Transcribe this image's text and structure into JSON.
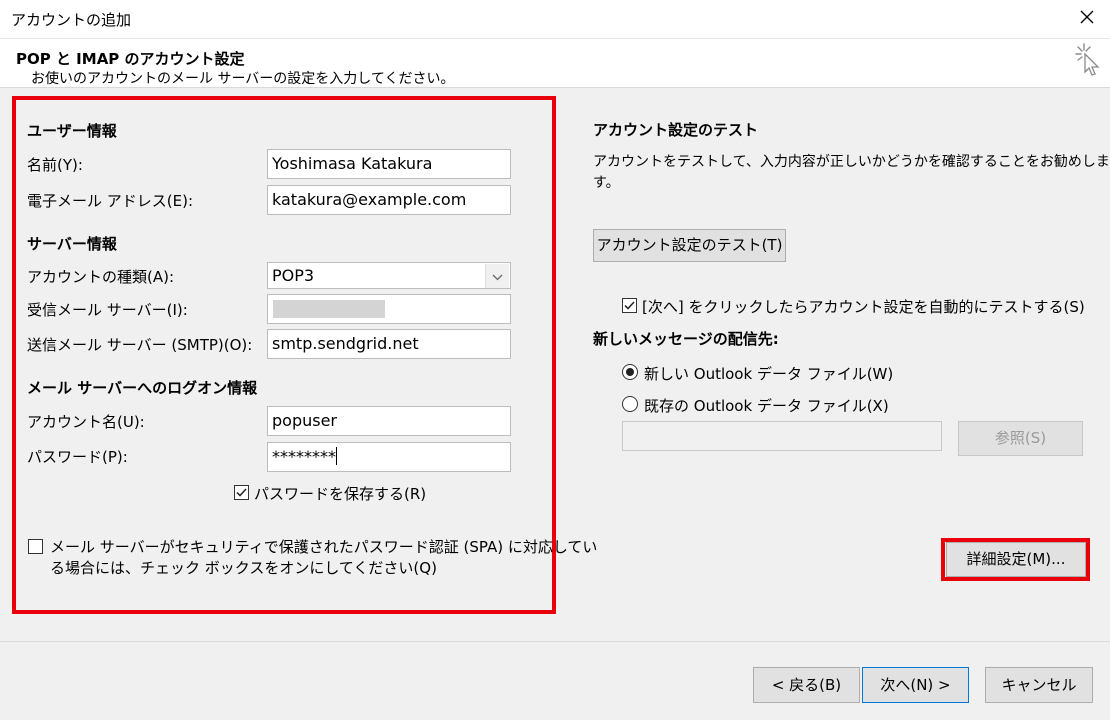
{
  "window": {
    "title": "アカウントの追加",
    "close_icon": "close-icon"
  },
  "header": {
    "title": "POP と IMAP のアカウント設定",
    "subtitle": "お使いのアカウントのメール サーバーの設定を入力してください。",
    "icon": "sparkle-cursor-icon"
  },
  "user_info": {
    "heading": "ユーザー情報",
    "name_label": "名前(Y):",
    "name_value": "Yoshimasa Katakura",
    "email_label": "電子メール アドレス(E):",
    "email_value": "katakura@example.com"
  },
  "server_info": {
    "heading": "サーバー情報",
    "account_type_label": "アカウントの種類(A):",
    "account_type_value": "POP3",
    "incoming_label": "受信メール サーバー(I):",
    "incoming_value": "",
    "outgoing_label": "送信メール サーバー (SMTP)(O):",
    "outgoing_value": "smtp.sendgrid.net"
  },
  "logon_info": {
    "heading": "メール サーバーへのログオン情報",
    "account_name_label": "アカウント名(U):",
    "account_name_value": "popuser",
    "password_label": "パスワード(P):",
    "password_value": "********",
    "save_password_label": "パスワードを保存する(R)",
    "save_password_checked": true,
    "spa_label_line1": "メール サーバーがセキュリティで保護されたパスワード認証 (SPA) に対応してい",
    "spa_label_line2": "る場合には、チェック ボックスをオンにしてください(Q)",
    "spa_checked": false
  },
  "test": {
    "heading": "アカウント設定のテスト",
    "desc_line1": "アカウントをテストして、入力内容が正しいかどうかを確認することをお勧めしま",
    "desc_line2": "す。",
    "test_button": "アカウント設定のテスト(T)",
    "auto_test_label": "[次へ] をクリックしたらアカウント設定を自動的にテストする(S)",
    "auto_test_checked": true
  },
  "delivery": {
    "heading": "新しいメッセージの配信先:",
    "new_file_label": "新しい Outlook データ ファイル(W)",
    "existing_file_label": "既存の Outlook データ ファイル(X)",
    "selected": "new",
    "existing_path_value": "",
    "browse_button": "参照(S)"
  },
  "more_settings_button": "詳細設定(M)...",
  "footer": {
    "back_button": "< 戻る(B)",
    "next_button": "次へ(N) >",
    "cancel_button": "キャンセル"
  }
}
